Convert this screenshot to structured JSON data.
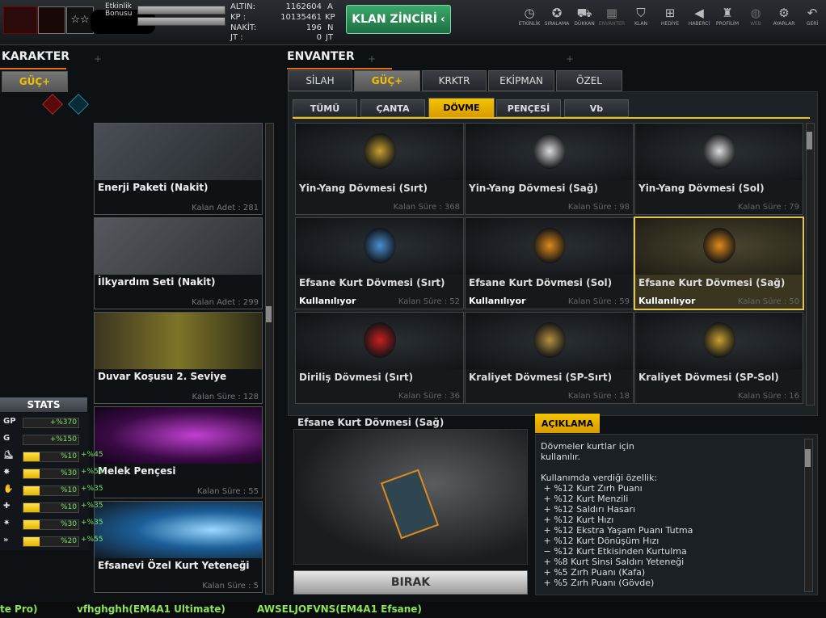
{
  "header": {
    "event_label": "Etkinlik",
    "bonus_label": "Bonusu",
    "currencies": [
      {
        "label": "ALTIN:",
        "value": "1162604",
        "unit": "A"
      },
      {
        "label": "KP :",
        "value": "10135461",
        "unit": "KP"
      },
      {
        "label": "NAKİT:",
        "value": "196",
        "unit": "N"
      },
      {
        "label": "JT :",
        "value": "0",
        "unit": "JT"
      }
    ],
    "clan_button": "KLAN ZİNCİRİ",
    "nav": [
      {
        "label": "ETKİNLİK",
        "icon": "clock-icon"
      },
      {
        "label": "SIRALAMA",
        "icon": "medal-icon"
      },
      {
        "label": "DÜKKAN",
        "icon": "cart-icon"
      },
      {
        "label": "ENVANTER",
        "icon": "inventory-icon"
      },
      {
        "label": "KLAN",
        "icon": "shield-icon"
      },
      {
        "label": "HEDİYE",
        "icon": "gift-icon"
      },
      {
        "label": "HABERCİ",
        "icon": "megaphone-icon"
      },
      {
        "label": "PROFİLİM",
        "icon": "profile-icon"
      },
      {
        "label": "WEB",
        "icon": "globe-icon"
      },
      {
        "label": "AYARLAR",
        "icon": "gear-icon"
      },
      {
        "label": "GERİ",
        "icon": "back-icon"
      }
    ]
  },
  "left": {
    "title": "KARAKTER",
    "tab": "GÜÇ+",
    "items": [
      {
        "name": "Enerji Paketi (Nakit)",
        "info": "Kalan Adet : 281"
      },
      {
        "name": "İlkyardım Seti (Nakit)",
        "info": "Kalan Adet : 299"
      },
      {
        "name": "Duvar Koşusu 2. Seviye",
        "info": "Kalan Süre : 128"
      },
      {
        "name": "Melek Pençesi",
        "info": "Kalan Süre : 55"
      },
      {
        "name": "Efsanevi Özel Kurt Yeteneği",
        "info": "Kalan Süre : 5"
      }
    ]
  },
  "stats": {
    "title": "STATS",
    "rows": [
      {
        "icon": "GP",
        "value": "+%370",
        "bonus": "",
        "level": 0
      },
      {
        "icon": "G",
        "value": "+%150",
        "bonus": "",
        "level": 0
      },
      {
        "icon": "boot-icon",
        "value": "%10",
        "bonus": "+%45",
        "level": 0.3
      },
      {
        "icon": "star-burst-icon",
        "value": "%30",
        "bonus": "+%55",
        "level": 0.3
      },
      {
        "icon": "hand-icon",
        "value": "%10",
        "bonus": "+%35",
        "level": 0.3
      },
      {
        "icon": "health-icon",
        "value": "%10",
        "bonus": "+%35",
        "level": 0.3
      },
      {
        "icon": "spark-icon",
        "value": "%30",
        "bonus": "+%35",
        "level": 0.3
      },
      {
        "icon": "chevron-double-icon",
        "value": "%20",
        "bonus": "+%55",
        "level": 0.3
      }
    ]
  },
  "right": {
    "title": "ENVANTER",
    "tabs": [
      "SİLAH",
      "GÜÇ+",
      "KRKTR",
      "EKİPMAN",
      "ÖZEL"
    ],
    "active_tab": 1,
    "subtabs": [
      "TÜMÜ",
      "ÇANTA",
      "DÖVME",
      "PENÇESİ",
      "Vb"
    ],
    "active_subtab": 2,
    "grid": [
      {
        "name": "Yin-Yang Dövmesi (Sırt)",
        "info": "Kalan Süre : 368",
        "used": "",
        "emblem": "#c9a030"
      },
      {
        "name": "Yin-Yang Dövmesi (Sağ)",
        "info": "Kalan Süre : 98",
        "used": "",
        "emblem": "#dddddd"
      },
      {
        "name": "Yin-Yang Dövmesi (Sol)",
        "info": "Kalan Süre : 79",
        "used": "",
        "emblem": "#dddddd"
      },
      {
        "name": "Efsane Kurt Dövmesi (Sırt)",
        "info": "Kalan Süre : 52",
        "used": "Kullanılıyor",
        "emblem": "#4a8fd0"
      },
      {
        "name": "Efsane Kurt Dövmesi (Sol)",
        "info": "Kalan Süre : 59",
        "used": "Kullanılıyor",
        "emblem": "#e08a1a"
      },
      {
        "name": "Efsane Kurt Dövmesi (Sağ)",
        "info": "Kalan Süre : 50",
        "used": "Kullanılıyor",
        "emblem": "#e08a1a"
      },
      {
        "name": "Diriliş Dövmesi (Sırt)",
        "info": "Kalan Süre : 36",
        "used": "",
        "emblem": "#c82020"
      },
      {
        "name": "Kraliyet Dövmesi (SP-Sırt)",
        "info": "Kalan Süre : 18",
        "used": "",
        "emblem": "#b59040"
      },
      {
        "name": "Kraliyet Dövmesi (SP-Sol)",
        "info": "Kalan Süre : 16",
        "used": "",
        "emblem": "#c9a030"
      }
    ],
    "selected_index": 5,
    "detail": {
      "title": "Efsane Kurt Dövmesi (Sağ)",
      "drop_button": "BIRAK",
      "desc_tab": "AÇIKLAMA",
      "desc": "Dövmeler kurtlar için\nkullanılır.\n\nKullanımda verdiği özellik:\n + %12 Kurt Zırh Puanı\n + %12 Kurt Menzili\n + %12 Saldırı Hasarı\n + %12 Kurt Hızı\n + %12 Ekstra Yaşam Puanı Tutma\n + %12 Kurt Dönüşüm Hızı\n − %12 Kurt Etkisinden Kurtulma\n + %8 Kurt Sinsi Saldırı Yeteneği\n + %5 Zırh Puanı (Kafa)\n + %5 Zırh Puanı (Gövde)"
    }
  },
  "ticker": [
    "te Pro)",
    "vfhghghh(EM4A1 Ultimate)",
    "AWSELJOFVNS(EM4A1 Efsane)"
  ],
  "colors": {
    "accent": "#f5c400",
    "clan_green": "#2e8b57",
    "used_text": "#ffffff",
    "stat_green": "#7be36a"
  }
}
